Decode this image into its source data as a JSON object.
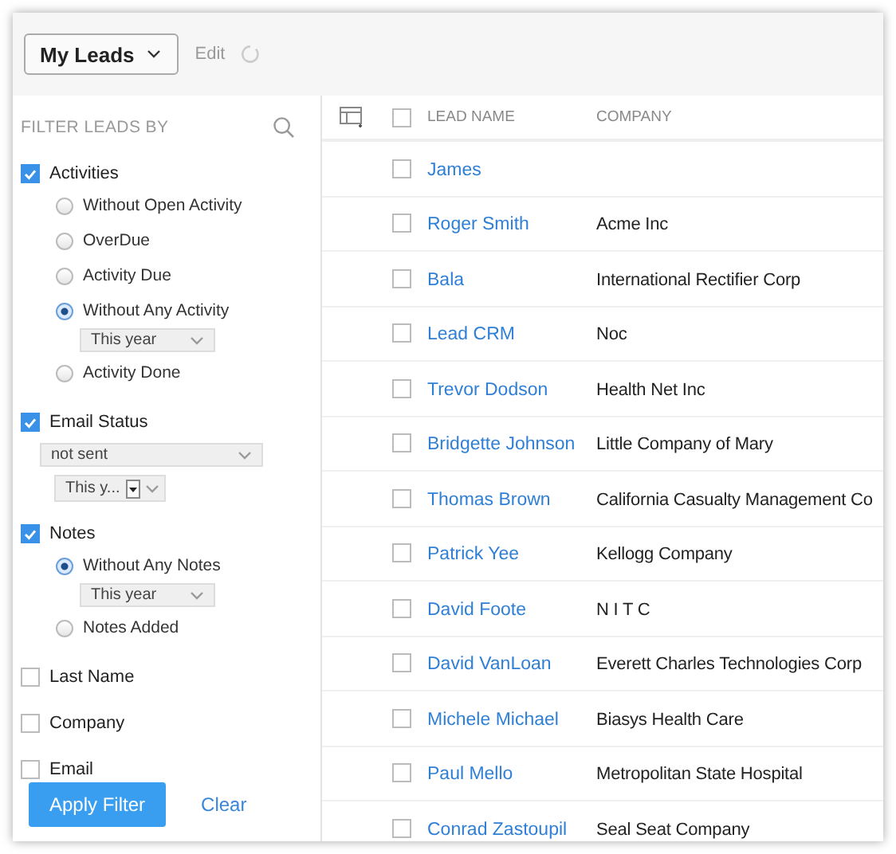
{
  "toolbar": {
    "view_menu": "My Leads",
    "edit": "Edit"
  },
  "sidebar": {
    "title": "FILTER LEADS BY",
    "filters": [
      {
        "label": "Activities",
        "checked": true,
        "options": [
          {
            "kind": "radio",
            "label": "Without Open Activity",
            "selected": false
          },
          {
            "kind": "radio",
            "label": "OverDue",
            "selected": false
          },
          {
            "kind": "radio",
            "label": "Activity Due",
            "selected": false
          },
          {
            "kind": "radio",
            "label": "Without Any Activity",
            "selected": true
          },
          {
            "kind": "select",
            "value": "This year"
          },
          {
            "kind": "radio",
            "label": "Activity Done",
            "selected": false
          }
        ]
      },
      {
        "label": "Email Status",
        "checked": true,
        "options": [
          {
            "kind": "wide-select",
            "value": "not sent"
          },
          {
            "kind": "small-select",
            "value": "This y..."
          }
        ]
      },
      {
        "label": "Notes",
        "checked": true,
        "options": [
          {
            "kind": "radio",
            "label": "Without Any Notes",
            "selected": true
          },
          {
            "kind": "select",
            "value": "This year"
          },
          {
            "kind": "radio",
            "label": "Notes Added",
            "selected": false
          }
        ]
      },
      {
        "label": "Last Name",
        "checked": false
      },
      {
        "label": "Company",
        "checked": false
      },
      {
        "label": "Email",
        "checked": false
      }
    ],
    "buttons": {
      "apply": "Apply Filter",
      "clear": "Clear"
    }
  },
  "table": {
    "select_all_checked": false,
    "columns": [
      "LEAD NAME",
      "COMPANY"
    ],
    "rows": [
      {
        "lead_name": "James",
        "company": "",
        "checked": false
      },
      {
        "lead_name": "Roger Smith",
        "company": "Acme Inc",
        "checked": false
      },
      {
        "lead_name": "Bala",
        "company": "International Rectifier Corp",
        "checked": false
      },
      {
        "lead_name": "Lead CRM",
        "company": "Noc",
        "checked": false
      },
      {
        "lead_name": "Trevor Dodson",
        "company": "Health Net Inc",
        "checked": false
      },
      {
        "lead_name": "Bridgette Johnson",
        "company": "Little Company of Mary",
        "checked": false
      },
      {
        "lead_name": "Thomas Brown",
        "company": "California Casualty Management Co",
        "checked": false
      },
      {
        "lead_name": "Patrick Yee",
        "company": "Kellogg Company",
        "checked": false
      },
      {
        "lead_name": "David Foote",
        "company": "N I T C",
        "checked": false
      },
      {
        "lead_name": "David VanLoan",
        "company": "Everett Charles Technologies Corp",
        "checked": false
      },
      {
        "lead_name": "Michele Michael",
        "company": "Biasys Health Care",
        "checked": false
      },
      {
        "lead_name": "Paul Mello",
        "company": "Metropolitan State Hospital",
        "checked": false
      },
      {
        "lead_name": "Conrad Zastoupil",
        "company": "Seal Seat Company",
        "checked": false
      }
    ]
  }
}
